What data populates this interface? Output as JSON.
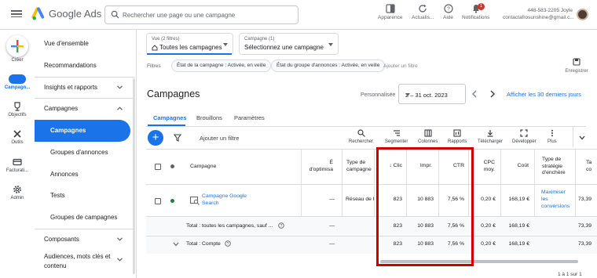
{
  "app": {
    "brand": "Google Ads"
  },
  "search": {
    "placeholder": "Rechercher une page ou une campagne"
  },
  "toolbar": {
    "appearance": "Apparence",
    "refresh": "Actualis...",
    "help": "Aide",
    "notifications": "Notifications",
    "notification_count": "1"
  },
  "account": {
    "id": "448-583-2205 Joyle",
    "email": "contactafrosunshine@gmail.c..."
  },
  "rail": {
    "create": "Créer",
    "campaigns": "Campagn...",
    "goals": "Objectifs",
    "tools": "Outils",
    "billing": "Facturati...",
    "admin": "Admin"
  },
  "sidenav": {
    "items": [
      {
        "label": "Vue d'ensemble"
      },
      {
        "label": "Recommandations"
      },
      {
        "label": "Insights et rapports"
      },
      {
        "label": "Campagnes"
      },
      {
        "label": "Campagnes"
      },
      {
        "label": "Groupes d'annonces"
      },
      {
        "label": "Annonces"
      },
      {
        "label": "Tests"
      },
      {
        "label": "Groupes de campagnes"
      },
      {
        "label": "Composants"
      },
      {
        "label": "Audiences, mots clés et"
      },
      {
        "label": "contenu"
      }
    ]
  },
  "filters": {
    "view_small": "Vue (2 filtres)",
    "view_main": "Toutes les campagnes",
    "campaign_small": "Campagne (1)",
    "campaign_main": "Sélectionnez une campagne",
    "label": "Filtres",
    "chips": [
      "État de la campagne : Activée, en veille",
      "État du groupe d'annonces : Activée, en veille"
    ],
    "add": "Ajouter un filtre",
    "export": "Enregistrer"
  },
  "page": {
    "title": "Campagnes",
    "date_label": "Personnalisée",
    "date_range": "2 – 31 oct. 2023",
    "show_last": "Afficher les 30 derniers jours"
  },
  "tabs": [
    "Campagnes",
    "Brouillons",
    "Paramètres"
  ],
  "table_toolbar": {
    "add_filter": "Ajouter un filtre",
    "tools": [
      "Rechercher",
      "Segmenter",
      "Colonnes",
      "Rapports",
      "Télécharger",
      "Développer",
      "Plus"
    ]
  },
  "table": {
    "headers": {
      "campaign": "Campagne",
      "optim_1": "É",
      "optim_2": "d'optimisa",
      "type_1": "Type de",
      "type_2": "campagne",
      "clicks": "Clic",
      "impr": "Impr.",
      "ctr": "CTR",
      "cpc_1": "CPC",
      "cpc_2": "moy.",
      "cost": "Coût",
      "strategy_1": "Type de",
      "strategy_2": "stratégie",
      "strategy_3": "d'enchère",
      "extra_1": "Ta",
      "extra_2": "co"
    },
    "rows": [
      {
        "name_1": "Campagne Google",
        "name_2": "Search",
        "optim": "—",
        "type": "Réseau de R",
        "clicks": "823",
        "impr": "10 883",
        "ctr": "7,56 %",
        "cpc": "0,20 €",
        "cost": "168,19 €",
        "strategy_1": "Maximiser",
        "strategy_2": "les",
        "strategy_3": "conversions",
        "extra": "73,39"
      }
    ],
    "total_filtered": {
      "label": "Total : toutes les campagnes, sauf ...",
      "optim": "—",
      "clicks": "823",
      "impr": "10 883",
      "ctr": "7,56 %",
      "cpc": "0,20 €",
      "cost": "168,19 €",
      "extra": "73,39"
    },
    "total_account": {
      "label": "Total : Compte",
      "optim": "—",
      "clicks": "823",
      "impr": "10 883",
      "ctr": "7,56 %",
      "cpc": "0,20 €",
      "cost": "168,19 €",
      "extra": "73,39"
    }
  },
  "pagination": "1 à 1 sur 1",
  "colors": {
    "accent": "#1a73e8",
    "highlight": "#d00000",
    "status_enabled": "#188038"
  }
}
